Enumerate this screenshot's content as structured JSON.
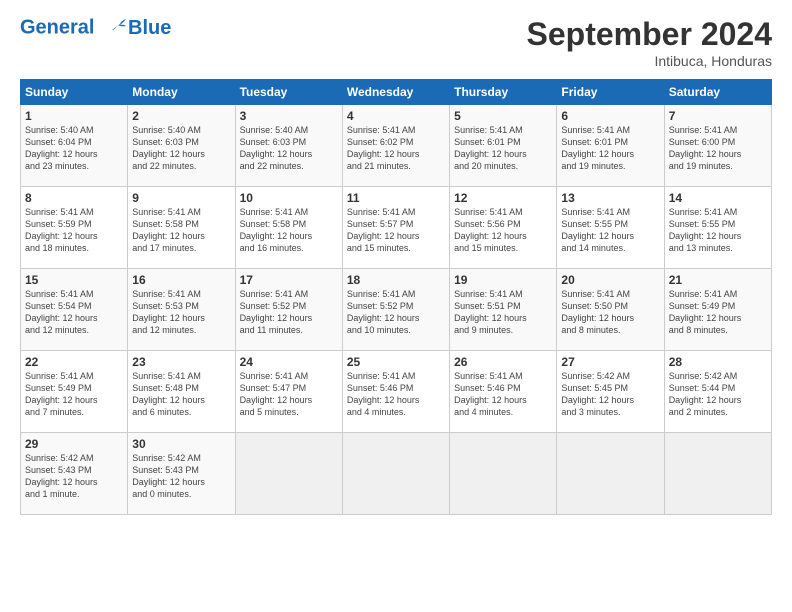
{
  "header": {
    "logo_line1": "General",
    "logo_line2": "Blue",
    "month": "September 2024",
    "location": "Intibuca, Honduras"
  },
  "days_of_week": [
    "Sunday",
    "Monday",
    "Tuesday",
    "Wednesday",
    "Thursday",
    "Friday",
    "Saturday"
  ],
  "weeks": [
    [
      {
        "num": "1",
        "lines": [
          "Sunrise: 5:40 AM",
          "Sunset: 6:04 PM",
          "Daylight: 12 hours",
          "and 23 minutes."
        ]
      },
      {
        "num": "2",
        "lines": [
          "Sunrise: 5:40 AM",
          "Sunset: 6:03 PM",
          "Daylight: 12 hours",
          "and 22 minutes."
        ]
      },
      {
        "num": "3",
        "lines": [
          "Sunrise: 5:40 AM",
          "Sunset: 6:03 PM",
          "Daylight: 12 hours",
          "and 22 minutes."
        ]
      },
      {
        "num": "4",
        "lines": [
          "Sunrise: 5:41 AM",
          "Sunset: 6:02 PM",
          "Daylight: 12 hours",
          "and 21 minutes."
        ]
      },
      {
        "num": "5",
        "lines": [
          "Sunrise: 5:41 AM",
          "Sunset: 6:01 PM",
          "Daylight: 12 hours",
          "and 20 minutes."
        ]
      },
      {
        "num": "6",
        "lines": [
          "Sunrise: 5:41 AM",
          "Sunset: 6:01 PM",
          "Daylight: 12 hours",
          "and 19 minutes."
        ]
      },
      {
        "num": "7",
        "lines": [
          "Sunrise: 5:41 AM",
          "Sunset: 6:00 PM",
          "Daylight: 12 hours",
          "and 19 minutes."
        ]
      }
    ],
    [
      {
        "num": "8",
        "lines": [
          "Sunrise: 5:41 AM",
          "Sunset: 5:59 PM",
          "Daylight: 12 hours",
          "and 18 minutes."
        ]
      },
      {
        "num": "9",
        "lines": [
          "Sunrise: 5:41 AM",
          "Sunset: 5:58 PM",
          "Daylight: 12 hours",
          "and 17 minutes."
        ]
      },
      {
        "num": "10",
        "lines": [
          "Sunrise: 5:41 AM",
          "Sunset: 5:58 PM",
          "Daylight: 12 hours",
          "and 16 minutes."
        ]
      },
      {
        "num": "11",
        "lines": [
          "Sunrise: 5:41 AM",
          "Sunset: 5:57 PM",
          "Daylight: 12 hours",
          "and 15 minutes."
        ]
      },
      {
        "num": "12",
        "lines": [
          "Sunrise: 5:41 AM",
          "Sunset: 5:56 PM",
          "Daylight: 12 hours",
          "and 15 minutes."
        ]
      },
      {
        "num": "13",
        "lines": [
          "Sunrise: 5:41 AM",
          "Sunset: 5:55 PM",
          "Daylight: 12 hours",
          "and 14 minutes."
        ]
      },
      {
        "num": "14",
        "lines": [
          "Sunrise: 5:41 AM",
          "Sunset: 5:55 PM",
          "Daylight: 12 hours",
          "and 13 minutes."
        ]
      }
    ],
    [
      {
        "num": "15",
        "lines": [
          "Sunrise: 5:41 AM",
          "Sunset: 5:54 PM",
          "Daylight: 12 hours",
          "and 12 minutes."
        ]
      },
      {
        "num": "16",
        "lines": [
          "Sunrise: 5:41 AM",
          "Sunset: 5:53 PM",
          "Daylight: 12 hours",
          "and 12 minutes."
        ]
      },
      {
        "num": "17",
        "lines": [
          "Sunrise: 5:41 AM",
          "Sunset: 5:52 PM",
          "Daylight: 12 hours",
          "and 11 minutes."
        ]
      },
      {
        "num": "18",
        "lines": [
          "Sunrise: 5:41 AM",
          "Sunset: 5:52 PM",
          "Daylight: 12 hours",
          "and 10 minutes."
        ]
      },
      {
        "num": "19",
        "lines": [
          "Sunrise: 5:41 AM",
          "Sunset: 5:51 PM",
          "Daylight: 12 hours",
          "and 9 minutes."
        ]
      },
      {
        "num": "20",
        "lines": [
          "Sunrise: 5:41 AM",
          "Sunset: 5:50 PM",
          "Daylight: 12 hours",
          "and 8 minutes."
        ]
      },
      {
        "num": "21",
        "lines": [
          "Sunrise: 5:41 AM",
          "Sunset: 5:49 PM",
          "Daylight: 12 hours",
          "and 8 minutes."
        ]
      }
    ],
    [
      {
        "num": "22",
        "lines": [
          "Sunrise: 5:41 AM",
          "Sunset: 5:49 PM",
          "Daylight: 12 hours",
          "and 7 minutes."
        ]
      },
      {
        "num": "23",
        "lines": [
          "Sunrise: 5:41 AM",
          "Sunset: 5:48 PM",
          "Daylight: 12 hours",
          "and 6 minutes."
        ]
      },
      {
        "num": "24",
        "lines": [
          "Sunrise: 5:41 AM",
          "Sunset: 5:47 PM",
          "Daylight: 12 hours",
          "and 5 minutes."
        ]
      },
      {
        "num": "25",
        "lines": [
          "Sunrise: 5:41 AM",
          "Sunset: 5:46 PM",
          "Daylight: 12 hours",
          "and 4 minutes."
        ]
      },
      {
        "num": "26",
        "lines": [
          "Sunrise: 5:41 AM",
          "Sunset: 5:46 PM",
          "Daylight: 12 hours",
          "and 4 minutes."
        ]
      },
      {
        "num": "27",
        "lines": [
          "Sunrise: 5:42 AM",
          "Sunset: 5:45 PM",
          "Daylight: 12 hours",
          "and 3 minutes."
        ]
      },
      {
        "num": "28",
        "lines": [
          "Sunrise: 5:42 AM",
          "Sunset: 5:44 PM",
          "Daylight: 12 hours",
          "and 2 minutes."
        ]
      }
    ],
    [
      {
        "num": "29",
        "lines": [
          "Sunrise: 5:42 AM",
          "Sunset: 5:43 PM",
          "Daylight: 12 hours",
          "and 1 minute."
        ]
      },
      {
        "num": "30",
        "lines": [
          "Sunrise: 5:42 AM",
          "Sunset: 5:43 PM",
          "Daylight: 12 hours",
          "and 0 minutes."
        ]
      },
      {
        "num": "",
        "lines": []
      },
      {
        "num": "",
        "lines": []
      },
      {
        "num": "",
        "lines": []
      },
      {
        "num": "",
        "lines": []
      },
      {
        "num": "",
        "lines": []
      }
    ]
  ]
}
